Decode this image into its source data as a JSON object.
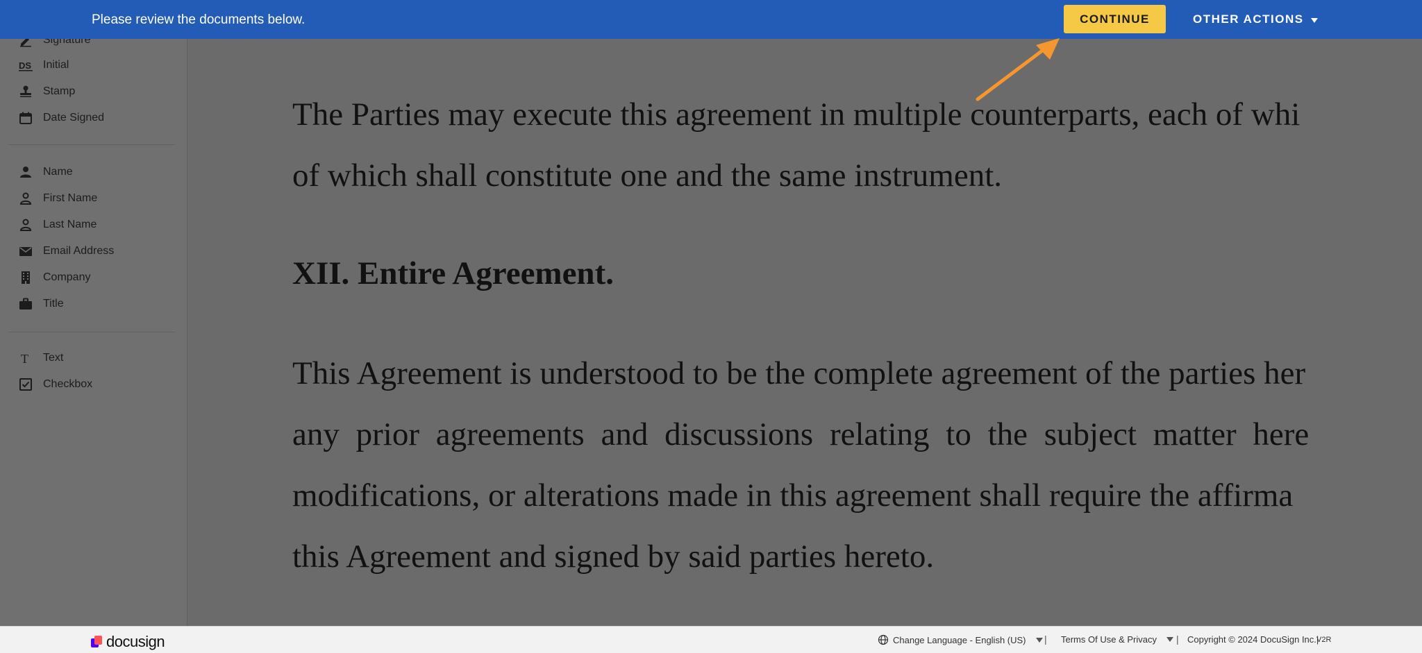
{
  "topbar": {
    "message": "Please review the documents below.",
    "continue_label": "CONTINUE",
    "other_actions_label": "OTHER ACTIONS"
  },
  "sidebar": {
    "group1": [
      {
        "label": "Signature",
        "icon": "pen-icon"
      },
      {
        "label": "Initial",
        "icon": "ds-icon"
      },
      {
        "label": "Stamp",
        "icon": "stamp-icon"
      },
      {
        "label": "Date Signed",
        "icon": "calendar-icon"
      }
    ],
    "group2": [
      {
        "label": "Name",
        "icon": "person-icon"
      },
      {
        "label": "First Name",
        "icon": "person-outline-icon"
      },
      {
        "label": "Last Name",
        "icon": "person-outline-icon"
      },
      {
        "label": "Email Address",
        "icon": "envelope-icon"
      },
      {
        "label": "Company",
        "icon": "building-icon"
      },
      {
        "label": "Title",
        "icon": "briefcase-icon"
      }
    ],
    "group3": [
      {
        "label": "Text",
        "icon": "text-icon"
      },
      {
        "label": "Checkbox",
        "icon": "checkbox-icon"
      }
    ]
  },
  "document": {
    "para1_line1": "The Parties may execute this agreement in multiple counterparts, each of whi",
    "para1_line2": "of which shall constitute one and the same instrument.",
    "heading": "XII. Entire Agreement.",
    "para2_line1": "This Agreement is understood to be the complete agreement of the parties her",
    "para2_line2": "any prior agreements and discussions relating to the subject matter here",
    "para2_line3": "modifications, or alterations made in this agreement shall require the affirma",
    "para2_line4": "this Agreement and signed by said parties hereto."
  },
  "footer": {
    "logo_text": "docusign",
    "language": "Change Language - English (US)",
    "terms": "Terms Of Use & Privacy",
    "copyright": "Copyright © 2024 DocuSign Inc.|",
    "version": "V2R",
    "separator": "|"
  },
  "colors": {
    "topbar": "#235cb7",
    "continue_button": "#f5c846",
    "overlay": "#6b6b6b",
    "arrow": "#f5962f"
  }
}
